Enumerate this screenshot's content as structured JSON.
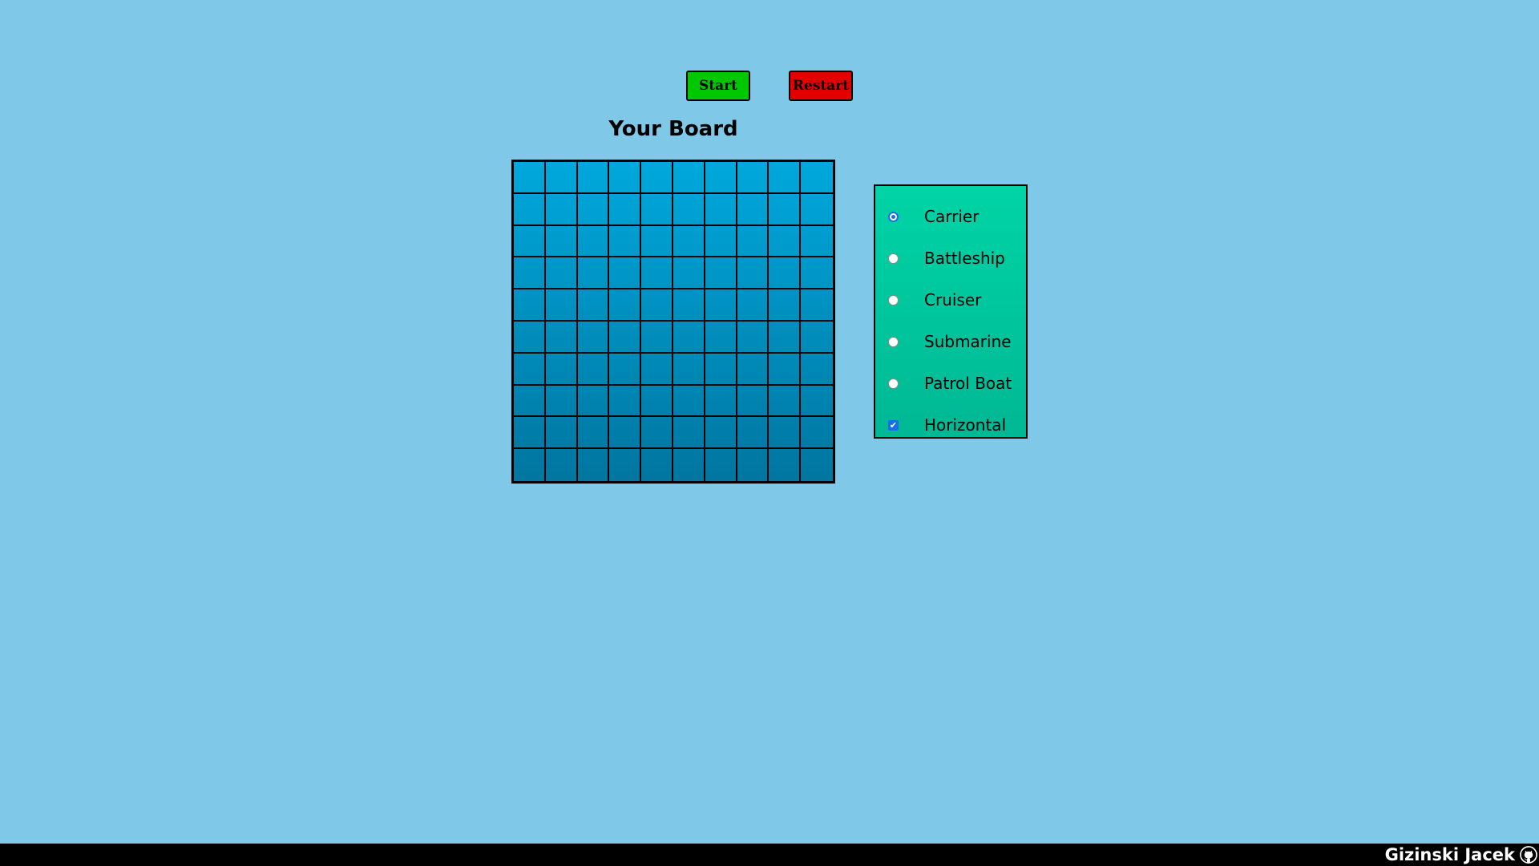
{
  "controls": {
    "start_label": "Start",
    "restart_label": "Restart",
    "start_color": "#00c800",
    "restart_color": "#e40000"
  },
  "board": {
    "title": "Your Board",
    "rows": 10,
    "cols": 10
  },
  "ship_selector": {
    "options": [
      {
        "label": "Carrier",
        "type": "radio",
        "checked": true
      },
      {
        "label": "Battleship",
        "type": "radio",
        "checked": false
      },
      {
        "label": "Cruiser",
        "type": "radio",
        "checked": false
      },
      {
        "label": "Submarine",
        "type": "radio",
        "checked": false
      },
      {
        "label": "Patrol Boat",
        "type": "radio",
        "checked": false
      },
      {
        "label": "Horizontal",
        "type": "checkbox",
        "checked": true
      }
    ]
  },
  "footer": {
    "author": "Gizinski Jacek",
    "icon": "github-icon"
  }
}
